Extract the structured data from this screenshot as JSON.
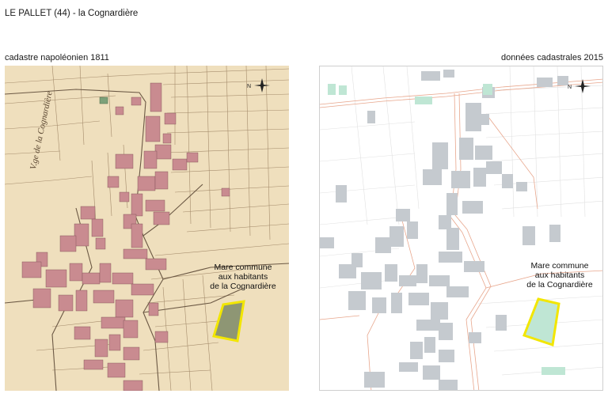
{
  "title": "LE PALLET (44) - la Cognardière",
  "left_map": {
    "label": "cadastre napoléonien 1811",
    "annotation": [
      "Mare commune",
      "aux habitants",
      "de la Cognardière"
    ],
    "street_label": "V.ge de la Cognardière",
    "north_letter": "N",
    "colors": {
      "paper": "#efdfbd",
      "buildings": "#c98b90",
      "lines": "#9c8467",
      "pond": "#7f8f6b",
      "highlight": "#f2e600"
    }
  },
  "right_map": {
    "label": "données cadastrales 2015",
    "annotation": [
      "Mare commune",
      "aux habitants",
      "de la Cognardière"
    ],
    "north_letter": "N",
    "colors": {
      "background": "#ffffff",
      "buildings": "#c5cacf",
      "roads": "#e8a68c",
      "parcels": "#e2e2e2",
      "pond": "#bfe6d4",
      "highlight": "#f2e600"
    }
  }
}
